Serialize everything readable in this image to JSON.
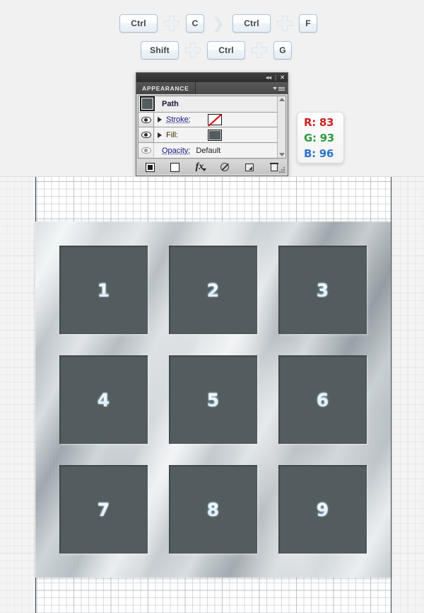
{
  "shortcuts": {
    "rows": [
      {
        "items": [
          {
            "type": "key",
            "label": "Ctrl",
            "size": "wide"
          },
          {
            "type": "plus"
          },
          {
            "type": "key",
            "label": "C",
            "size": "narrow"
          },
          {
            "type": "chevron",
            "label": "❯"
          },
          {
            "type": "key",
            "label": "Ctrl",
            "size": "wide"
          },
          {
            "type": "plus"
          },
          {
            "type": "key",
            "label": "F",
            "size": "narrow"
          }
        ]
      },
      {
        "items": [
          {
            "type": "key",
            "label": "Shift",
            "size": "wide"
          },
          {
            "type": "plus"
          },
          {
            "type": "key",
            "label": "Ctrl",
            "size": "wide"
          },
          {
            "type": "plus"
          },
          {
            "type": "key",
            "label": "G",
            "size": "narrow"
          }
        ]
      }
    ]
  },
  "panel": {
    "title": "APPEARANCE",
    "collapse_icon": "◂◂",
    "close_icon": "✕",
    "divider": "|",
    "menu_icon": "panel-menu-icon",
    "target_label": "Path",
    "rows": [
      {
        "label": "Stroke:",
        "value": "None",
        "swatch": "none"
      },
      {
        "label": "Fill:",
        "value": "#535D60",
        "swatch": "fill"
      },
      {
        "label": "Opacity:",
        "value": "Default",
        "swatch": "none-shown"
      }
    ],
    "footer_buttons": [
      {
        "name": "add-new-stroke-button",
        "icon": "filled-square-icon"
      },
      {
        "name": "add-new-fill-button",
        "icon": "open-square-icon"
      },
      {
        "name": "add-new-effect-button",
        "icon": "fx-icon"
      },
      {
        "name": "clear-appearance-button",
        "icon": "no-symbol-icon"
      },
      {
        "name": "duplicate-item-button",
        "icon": "duplicate-icon"
      },
      {
        "name": "delete-item-button",
        "icon": "trash-icon"
      }
    ]
  },
  "color_callout": {
    "r_label": "R: 83",
    "g_label": "G: 93",
    "b_label": "B: 96",
    "r_color": "#cc2222",
    "g_color": "#2e9b3e",
    "b_color": "#2f74c8",
    "hex": "#535D60"
  },
  "artwork": {
    "tile_color": "#535D60",
    "number_color": "#6fb4ec",
    "tiles": [
      {
        "label": "1"
      },
      {
        "label": "2"
      },
      {
        "label": "3"
      },
      {
        "label": "4"
      },
      {
        "label": "5"
      },
      {
        "label": "6"
      },
      {
        "label": "7"
      },
      {
        "label": "8"
      },
      {
        "label": "9"
      }
    ]
  }
}
